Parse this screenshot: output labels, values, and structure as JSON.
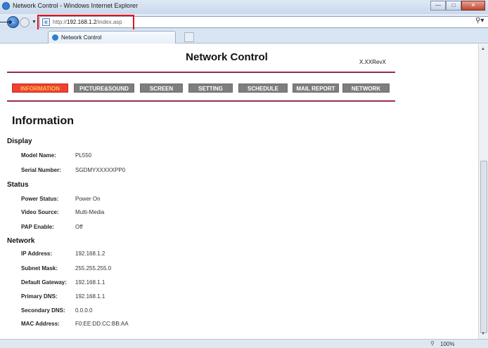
{
  "browser": {
    "window_title": "Network Control - Windows Internet Explorer",
    "address_prefix": "http://",
    "address_host": "192.168.1.2",
    "address_path": "/index.asp",
    "tab_label": "Network Control",
    "zoom_level": "100%",
    "icons": [
      "back-arrow-icon",
      "forward-arrow-icon",
      "page-icon",
      "search-icon",
      "zoom-icon"
    ]
  },
  "page": {
    "title": "Network Control",
    "version": "X.XXRevX",
    "menu": [
      {
        "label": "INFORMATION",
        "active": true
      },
      {
        "label": "PICTURE&SOUND",
        "active": false
      },
      {
        "label": "SCREEN",
        "active": false
      },
      {
        "label": "SETTING",
        "active": false
      },
      {
        "label": "SCHEDULE",
        "active": false
      },
      {
        "label": "MAIL REPORT",
        "active": false
      },
      {
        "label": "NETWORK",
        "active": false
      }
    ],
    "heading": "Information",
    "sections": {
      "display": {
        "title": "Display",
        "rows": [
          {
            "label": "Model Name:",
            "value": "PL550"
          },
          {
            "label": "Serial Number:",
            "value": "SGDMYXXXXXPP0"
          }
        ]
      },
      "status": {
        "title": "Status",
        "rows": [
          {
            "label": "Power Status:",
            "value": "Power On"
          },
          {
            "label": "Video Source:",
            "value": "Multi-Media"
          },
          {
            "label": "PAP Enable:",
            "value": "Off"
          }
        ]
      },
      "network": {
        "title": "Network",
        "rows": [
          {
            "label": "IP Address:",
            "value": "192.168.1.2"
          },
          {
            "label": "Subnet Mask:",
            "value": "255.255.255.0"
          },
          {
            "label": "Default Gateway:",
            "value": "192.168.1.1"
          },
          {
            "label": "Primary DNS:",
            "value": "192.168.1.1"
          },
          {
            "label": "Secondary DNS:",
            "value": "0.0.0.0"
          },
          {
            "label": "MAC Address:",
            "value": "F0:EE:DD:CC:BB:AA"
          }
        ]
      }
    }
  },
  "colors": {
    "active_menu_bg": "#ef4034",
    "active_menu_text": "#f7c14c",
    "menu_bg": "#7e7e7e",
    "rule": "#9b2c48",
    "highlight_box": "#e0141e"
  }
}
